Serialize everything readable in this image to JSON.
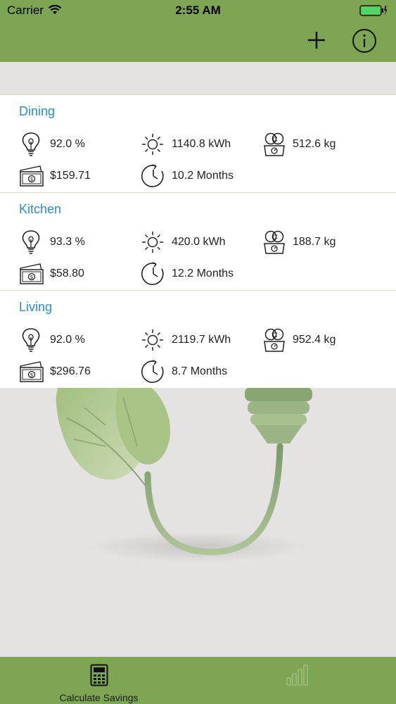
{
  "status_bar": {
    "carrier": "Carrier",
    "time": "2:55 AM"
  },
  "nav": {
    "add_icon": "plus-icon",
    "info_icon": "info-icon"
  },
  "rooms": [
    {
      "name": "Dining",
      "efficiency": "92.0 %",
      "energy": "1140.8 kWh",
      "co2": "512.6 kg",
      "savings": "$159.71",
      "payback": "10.2 Months"
    },
    {
      "name": "Kitchen",
      "efficiency": "93.3 %",
      "energy": "420.0 kWh",
      "co2": "188.7 kg",
      "savings": "$58.80",
      "payback": "12.2 Months"
    },
    {
      "name": "Living",
      "efficiency": "92.0 %",
      "energy": "2119.7 kWh",
      "co2": "952.4 kg",
      "savings": "$296.76",
      "payback": "8.7 Months"
    }
  ],
  "tabs": [
    {
      "label": "Calculate Savings",
      "icon": "calculator-icon",
      "active": true
    },
    {
      "label": "",
      "icon": "bar-chart-icon",
      "active": false
    }
  ],
  "colors": {
    "accent": "#7da653",
    "title_blue": "#2a8ccf",
    "background": "#e4e3e2"
  }
}
